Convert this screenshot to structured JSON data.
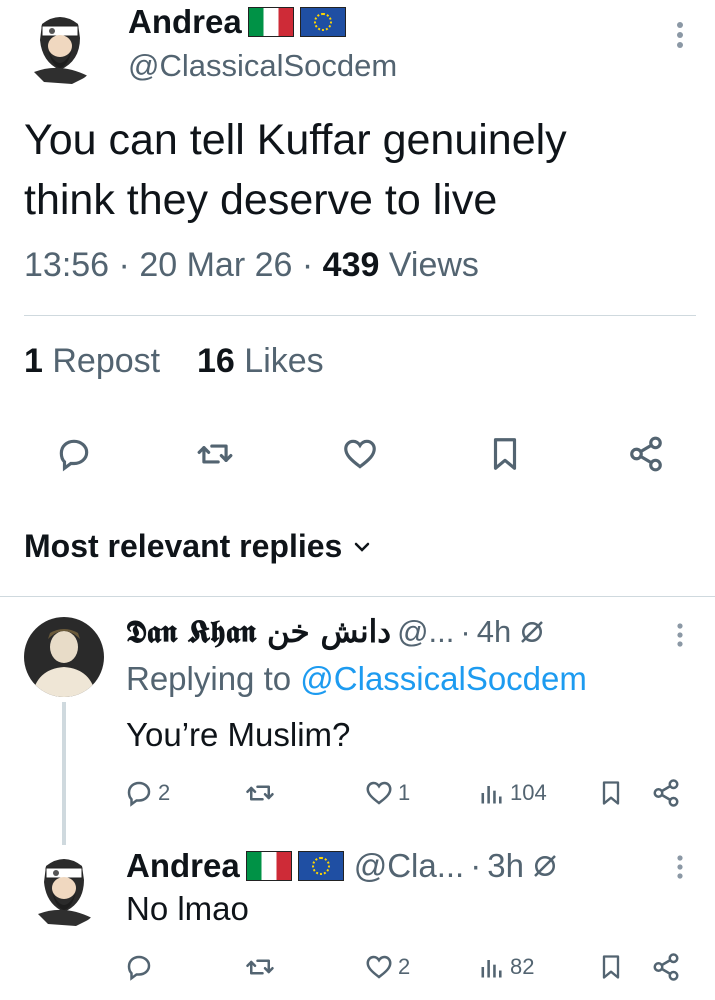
{
  "tweet": {
    "author_name": "Andrea",
    "author_handle": "@ClassicalSocdem",
    "text_line1": "You can tell Kuffar genuinely",
    "text_line2": "think they deserve to live",
    "time": "13:56",
    "date": "20 Mar 26",
    "views_count": "439",
    "views_label": "Views",
    "reposts_count": "1",
    "reposts_label": "Repost",
    "likes_count": "16",
    "likes_label": "Likes"
  },
  "replies_header": {
    "label": "Most relevant replies"
  },
  "replies": [
    {
      "author_name": "𝕯𝖆𝖓 𝕶𝖍𝖆𝖓 دانش خن",
      "author_handle": "@...",
      "time": "4h",
      "replying_prefix": "Replying to",
      "replying_to": "@ClassicalSocdem",
      "text": "You’re Muslim?",
      "replies_count": "2",
      "likes_count": "1",
      "views_count": "104"
    },
    {
      "author_name": "Andrea",
      "author_handle": "@Cla...",
      "time": "3h",
      "text": "No lmao",
      "likes_count": "2",
      "views_count": "82"
    }
  ],
  "colors": {
    "accent": "#1d9bf0",
    "muted": "#536471",
    "text": "#0f1419",
    "divider": "#cfd9de"
  }
}
